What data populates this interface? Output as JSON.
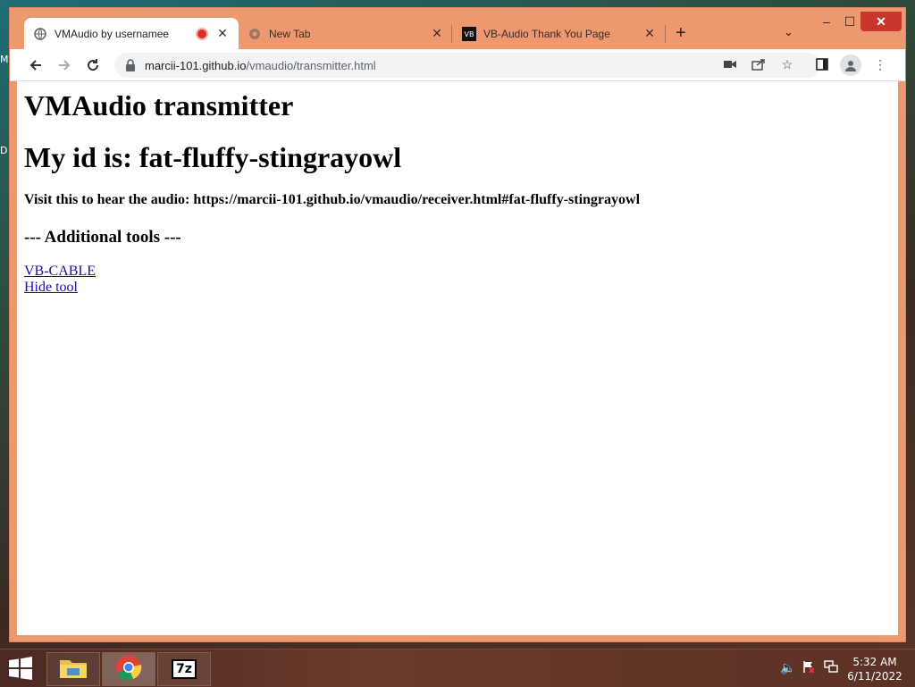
{
  "desktop": {
    "labels": [
      "M",
      "D"
    ]
  },
  "browser": {
    "tabs": [
      {
        "title": "VMAudio by usernamee",
        "active": true
      },
      {
        "title": "New Tab",
        "active": false
      },
      {
        "title": "VB-Audio Thank You Page",
        "active": false
      }
    ],
    "new_tab_symbol": "+",
    "tab_search_symbol": "⌄",
    "window_controls": {
      "minimize": "–",
      "maximize": "☐",
      "close": "✕"
    },
    "address": {
      "host": "marcii-101.github.io",
      "path": "/vmaudio/transmitter.html"
    },
    "icons": [
      "back-icon",
      "forward-icon",
      "reload-icon",
      "lock-icon",
      "camera-icon",
      "share-icon",
      "star-icon",
      "side-panel-icon",
      "profile-icon",
      "menu-icon"
    ]
  },
  "page": {
    "heading": "VMAudio transmitter",
    "id_heading": "My id is: fat-fluffy-stingrayowl",
    "visit_text": "Visit this to hear the audio: https://marcii-101.github.io/vmaudio/receiver.html#fat-fluffy-stingrayowl",
    "tools_heading": "--- Additional tools ---",
    "links": [
      "VB-CABLE",
      "Hide tool"
    ]
  },
  "taskbar": {
    "items": [
      "file-explorer",
      "chrome",
      "7-zip"
    ],
    "sevenzip_label": "7z",
    "clock": {
      "time": "5:32 AM",
      "date": "6/11/2022"
    }
  }
}
